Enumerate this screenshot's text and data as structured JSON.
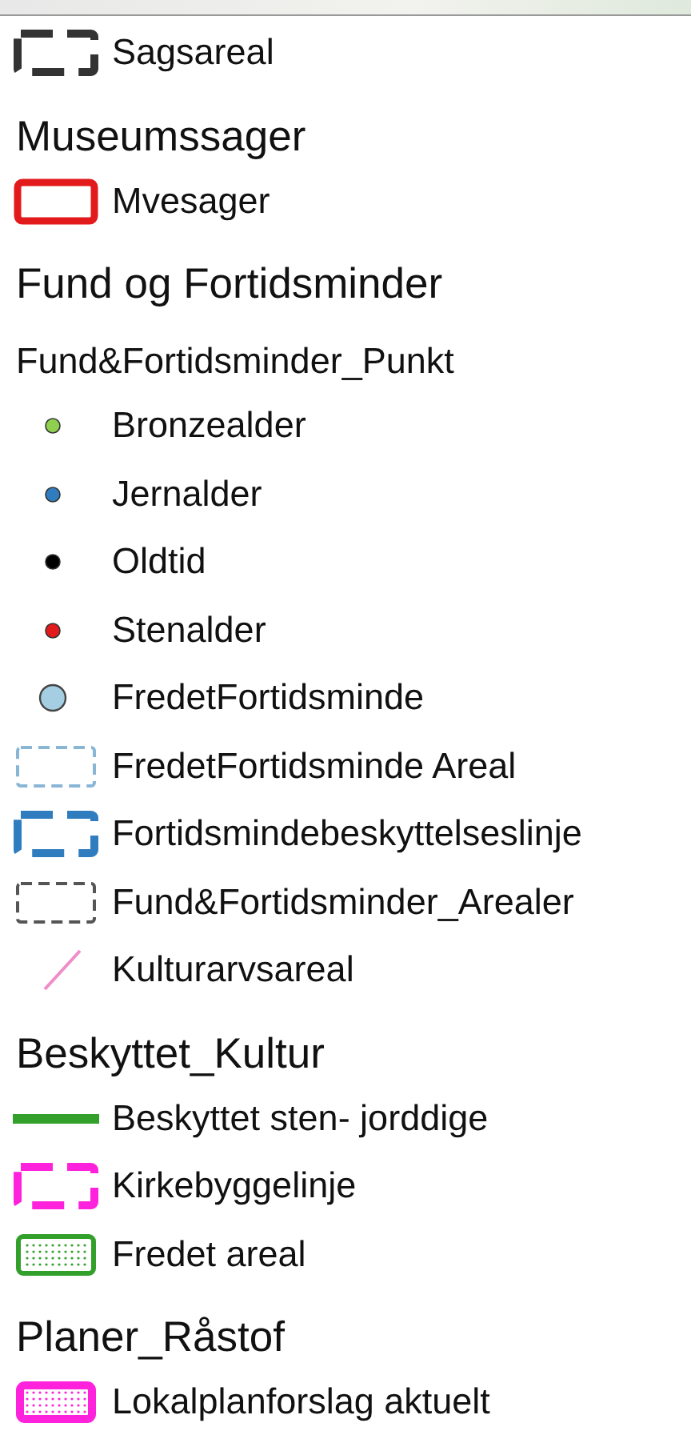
{
  "legend": [
    {
      "kind": "bracket-box",
      "label": "Sagsareal",
      "color": "#333333"
    },
    {
      "kind": "group",
      "label": "Museumssager"
    },
    {
      "kind": "box",
      "label": "Mvesager",
      "color": "#e31a1c"
    },
    {
      "kind": "group",
      "label": "Fund og Fortidsminder"
    },
    {
      "kind": "subgroup",
      "label": "Fund&Fortidsminder_Punkt"
    },
    {
      "kind": "dot",
      "label": "Bronzealder",
      "color": "#8fd14f"
    },
    {
      "kind": "dot",
      "label": "Jernalder",
      "color": "#2f7dbf"
    },
    {
      "kind": "dot",
      "label": "Oldtid",
      "color": "#000000"
    },
    {
      "kind": "dot",
      "label": "Stenalder",
      "color": "#e31a1c"
    },
    {
      "kind": "large-dot",
      "label": "FredetFortidsminde",
      "color": "#a6cee3"
    },
    {
      "kind": "dashed-box",
      "label": "FredetFortidsminde Areal",
      "color": "#8ab6d6"
    },
    {
      "kind": "bracket-box",
      "label": "Fortidsmindebeskyttelseslinje",
      "color": "#2f7dbf"
    },
    {
      "kind": "dashed-box",
      "label": "Fund&Fortidsminder_Arealer",
      "color": "#555555"
    },
    {
      "kind": "diagonal",
      "label": "Kulturarvsareal",
      "color": "#f08cc8"
    },
    {
      "kind": "group",
      "label": "Beskyttet_Kultur"
    },
    {
      "kind": "line",
      "label": "Beskyttet sten- jorddige",
      "color": "#33a02c"
    },
    {
      "kind": "bracket-box",
      "label": "Kirkebyggelinje",
      "color": "#ff22dd"
    },
    {
      "kind": "dotted-box",
      "label": "Fredet areal",
      "color": "#33a02c"
    },
    {
      "kind": "group",
      "label": "Planer_Råstof"
    },
    {
      "kind": "dotted-box-thick",
      "label": "Lokalplanforslag aktuelt",
      "color": "#ff22dd"
    }
  ]
}
